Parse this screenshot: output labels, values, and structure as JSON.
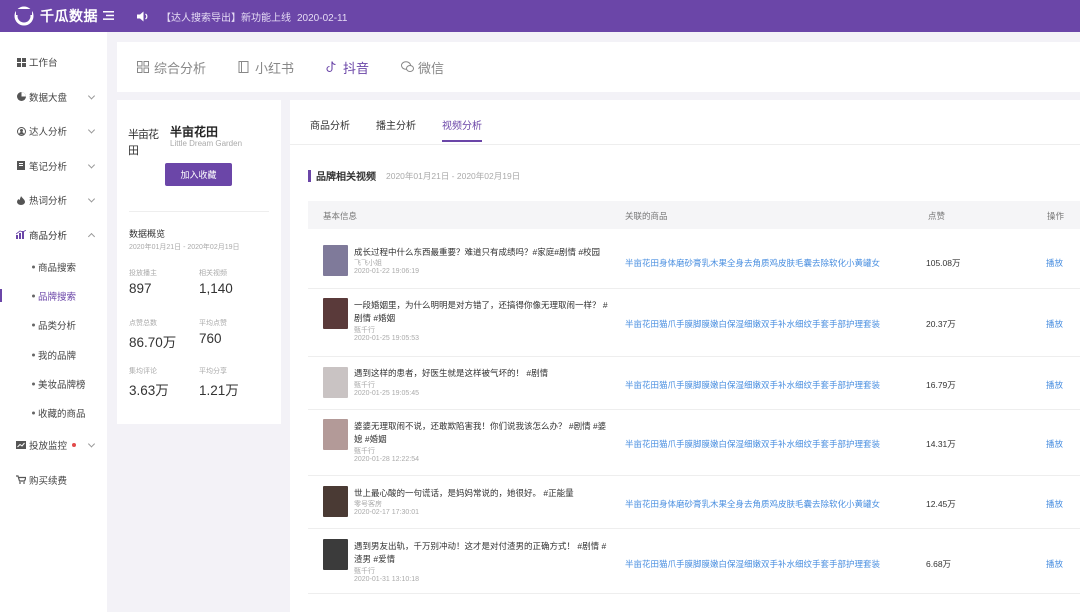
{
  "app": {
    "name": "千瓜数据",
    "notice_text": "【达人搜索导出】新功能上线",
    "notice_date": "2020-02-11"
  },
  "sidebar": {
    "items": [
      {
        "label": "工作台",
        "icon": "workbench-icon"
      },
      {
        "label": "数据大盘",
        "icon": "dashboard-icon"
      },
      {
        "label": "达人分析",
        "icon": "influencer-icon"
      },
      {
        "label": "笔记分析",
        "icon": "note-icon"
      },
      {
        "label": "热词分析",
        "icon": "fire-icon"
      },
      {
        "label": "商品分析",
        "icon": "chart-icon"
      }
    ],
    "sub_items": [
      {
        "label": "商品搜索"
      },
      {
        "label": "品牌搜索"
      },
      {
        "label": "品类分析"
      },
      {
        "label": "我的品牌"
      },
      {
        "label": "美妆品牌榜"
      },
      {
        "label": "收藏的商品"
      }
    ],
    "bottom_items": [
      {
        "label": "投放监控",
        "icon": "monitor-icon"
      },
      {
        "label": "购买续费",
        "icon": "cart-icon"
      }
    ]
  },
  "platform_tabs": [
    {
      "label": "综合分析",
      "icon": "grid-icon"
    },
    {
      "label": "小红书",
      "icon": "book-icon"
    },
    {
      "label": "抖音",
      "icon": "douyin-icon"
    },
    {
      "label": "微信",
      "icon": "wechat-icon"
    }
  ],
  "brand": {
    "logo_text": "半亩花田",
    "name": "半亩花田",
    "name_en": "Little Dream Garden",
    "favorite_button": "加入收藏",
    "overview_title": "数据概览",
    "overview_range": "2020年01月21日 - 2020年02月19日",
    "stats": [
      {
        "label": "投放播主",
        "value": "897"
      },
      {
        "label": "相关视频",
        "value": "1,140"
      },
      {
        "label": "点赞总数",
        "value": "86.70万"
      },
      {
        "label": "平均点赞",
        "value": "760"
      },
      {
        "label": "集均评论",
        "value": "3.63万"
      },
      {
        "label": "平均分享",
        "value": "1.21万"
      }
    ]
  },
  "sub_tabs": [
    {
      "label": "商品分析"
    },
    {
      "label": "播主分析"
    },
    {
      "label": "视频分析"
    }
  ],
  "section": {
    "title": "品牌相关视频",
    "range": "2020年01月21日 - 2020年02月19日"
  },
  "table": {
    "headers": [
      "基本信息",
      "关联的商品",
      "点赞",
      "操作"
    ],
    "rows": [
      {
        "title": "成长过程中什么东西最重要？难道只有成绩吗？#家庭#剧情 #校园",
        "author": "飞飞小姐",
        "time": "2020-01-22 19:06:19",
        "product": "半亩花田身体磨砂膏乳木果全身去角质鸡皮肤毛囊去除软化小黄罐女",
        "likes": "105.08万",
        "action": "播放",
        "thumb_color": "#7f7a9a"
      },
      {
        "title": "一段婚姻里，为什么明明是对方错了，还搞得你像无理取闹一样？ #剧情 #婚姻",
        "author": "甄千行",
        "time": "2020-01-25 19:05:53",
        "product": "半亩花田猫爪手膜脚膜嫩白保湿细嫩双手补水细纹手套手部护理套装",
        "likes": "20.37万",
        "action": "播放",
        "thumb_color": "#5a3a3a"
      },
      {
        "title": "遇到这样的患者，好医生就是这样被气坏的！ #剧情",
        "author": "甄千行",
        "time": "2020-01-25 19:05:45",
        "product": "半亩花田猫爪手膜脚膜嫩白保湿细嫩双手补水细纹手套手部护理套装",
        "likes": "16.79万",
        "action": "播放",
        "thumb_color": "#c9c3c3"
      },
      {
        "title": "婆婆无理取闹不说，还敢欺陷害我！你们说我该怎么办？ #剧情 #婆媳 #婚姻",
        "author": "甄千行",
        "time": "2020-01-28 12:22:54",
        "product": "半亩花田猫爪手膜脚膜嫩白保湿细嫩双手补水细纹手套手部护理套装",
        "likes": "14.31万",
        "action": "播放",
        "thumb_color": "#b39a98"
      },
      {
        "title": "世上最心酸的一句谎话，是妈妈常说的，她很好。 #正能量",
        "author": "零号客房",
        "time": "2020-02-17 17:30:01",
        "product": "半亩花田身体磨砂膏乳木果全身去角质鸡皮肤毛囊去除软化小黄罐女",
        "likes": "12.45万",
        "action": "播放",
        "thumb_color": "#4a3a34"
      },
      {
        "title": "遇到男友出轨，千万别冲动！这才是对付渣男的正确方式！ #剧情 #渣男 #爱情",
        "author": "甄千行",
        "time": "2020-01-31 13:10:18",
        "product": "半亩花田猫爪手膜脚膜嫩白保湿细嫩双手补水细纹手套手部护理套装",
        "likes": "6.68万",
        "action": "播放",
        "thumb_color": "#3b3b3b"
      }
    ]
  }
}
